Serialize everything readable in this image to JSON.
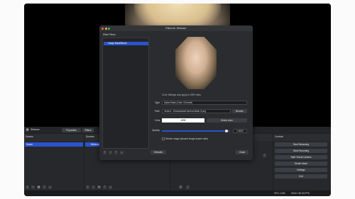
{
  "top": {
    "source_label": "Webcam",
    "properties_label": "Properties",
    "filters_label": "Filters"
  },
  "scenes": {
    "title": "Scenes",
    "items": [
      "Scene"
    ]
  },
  "sources": {
    "title": "Sources",
    "items": [
      "Webcam"
    ]
  },
  "controls": {
    "title": "Controls",
    "buttons": [
      "Start Streaming",
      "Start Recording",
      "Start Virtual Camera",
      "Studio Mode",
      "Settings",
      "Exit"
    ]
  },
  "status": {
    "cpu": "CPU: 2.5%",
    "time": "00:00 / 60.00 FPS"
  },
  "dialog": {
    "title": "Filters for 'Webcam'",
    "list_title": "Effect Filters",
    "filter_item": "Image Mask/Blend",
    "info": "Color Settings only apply to SDR video.",
    "type_label": "Type",
    "type_value": "Alpha Mask (Color Channel)",
    "path_label": "Path",
    "path_value": "/Users/.../Downloads/Camera Mask 3.png",
    "browse_label": "Browse",
    "color_label": "Color",
    "color_value": "#ffffff",
    "select_color_label": "Select color",
    "opacity_label": "Opacity",
    "opacity_value": "1.0000",
    "stretch_label": "Stretch Image (discard image aspect ratio)",
    "defaults_label": "Defaults",
    "close_label": "Close",
    "opacity_fraction": 0.95
  },
  "colors": {
    "accent": "#2a53cc",
    "window_bg": "#1e2022",
    "dialog_bg": "#2a2c2f"
  }
}
